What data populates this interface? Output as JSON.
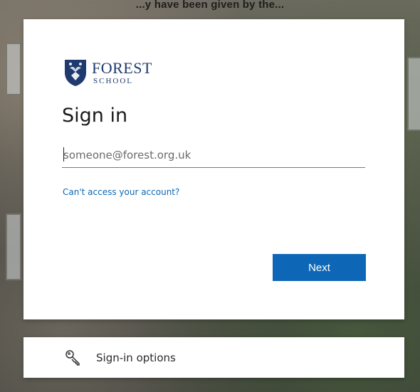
{
  "page": {
    "caption": "...y have been given by the...",
    "accent_color": "#0e67b6",
    "brand_color": "#1f3a6e"
  },
  "logo": {
    "name": "FOREST",
    "sub": "SCHOOL",
    "icon": "crest-icon"
  },
  "signin": {
    "title": "Sign in",
    "email_placeholder": "someone@forest.org.uk",
    "email_value": "",
    "help_link": "Can't access your account?",
    "next_label": "Next"
  },
  "options": {
    "label": "Sign-in options",
    "icon": "key-icon"
  }
}
